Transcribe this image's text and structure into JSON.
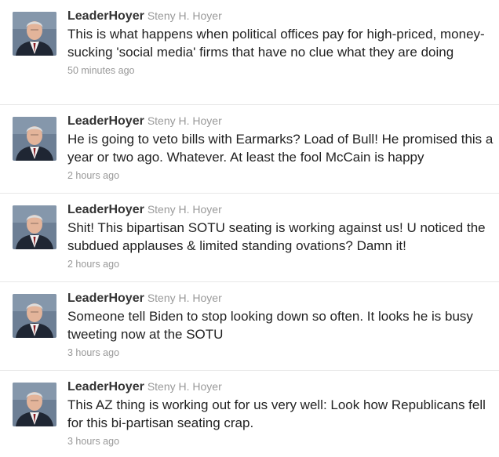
{
  "tweets": [
    {
      "screen_name": "LeaderHoyer",
      "full_name": "Steny H. Hoyer",
      "text": "This is what happens when political offices pay for high-priced, money-sucking 'social media' firms that have no clue what they are doing",
      "timestamp": "50 minutes ago",
      "avatar_icon": "profile-photo-avatar"
    },
    {
      "screen_name": "LeaderHoyer",
      "full_name": "Steny H. Hoyer",
      "text": "He is going to veto bills with Earmarks? Load of Bull! He promised this a year or two ago. Whatever. At least the fool McCain is happy",
      "timestamp": "2 hours ago",
      "avatar_icon": "profile-photo-avatar"
    },
    {
      "screen_name": "LeaderHoyer",
      "full_name": "Steny H. Hoyer",
      "text": "Shit! This bipartisan SOTU seating is working against us! U noticed the subdued applauses & limited standing ovations? Damn it!",
      "timestamp": "2 hours ago",
      "avatar_icon": "profile-photo-avatar"
    },
    {
      "screen_name": "LeaderHoyer",
      "full_name": "Steny H. Hoyer",
      "text": "Someone tell Biden to stop looking down so often. It looks he is busy tweeting now at the SOTU",
      "timestamp": "3 hours ago",
      "avatar_icon": "profile-photo-avatar"
    },
    {
      "screen_name": "LeaderHoyer",
      "full_name": "Steny H. Hoyer",
      "text": "This AZ thing is working out for us very well: Look how Republicans fell for this bi-partisan seating crap.",
      "timestamp": "3 hours ago",
      "avatar_icon": "profile-photo-avatar"
    }
  ],
  "colors": {
    "screen_name": "#333333",
    "full_name": "#999999",
    "text": "#222222",
    "timestamp": "#999999",
    "divider": "#e8e8e8"
  }
}
